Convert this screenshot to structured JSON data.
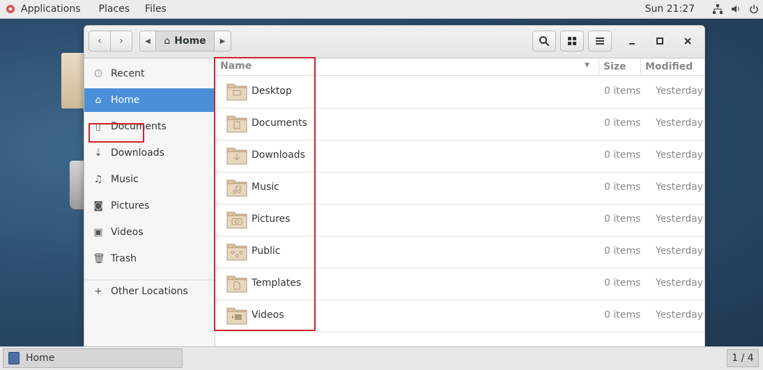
{
  "topbar": {
    "applications": "Applications",
    "places": "Places",
    "files": "Files",
    "clock": "Sun 21:27",
    "tray": [
      "network-icon",
      "volume-icon",
      "power-icon"
    ]
  },
  "header": {
    "path_home": "Home"
  },
  "sidebar": {
    "items": [
      {
        "label": "Recent",
        "icon": "clock-icon"
      },
      {
        "label": "Home",
        "icon": "home-icon",
        "selected": true
      },
      {
        "label": "Documents",
        "icon": "document-icon"
      },
      {
        "label": "Downloads",
        "icon": "download-icon"
      },
      {
        "label": "Music",
        "icon": "music-icon"
      },
      {
        "label": "Pictures",
        "icon": "camera-icon"
      },
      {
        "label": "Videos",
        "icon": "video-icon"
      },
      {
        "label": "Trash",
        "icon": "trash-icon"
      },
      {
        "label": "Other Locations",
        "icon": "plus-icon"
      }
    ]
  },
  "list": {
    "columns": {
      "name": "Name",
      "size": "Size",
      "modified": "Modified"
    },
    "rows": [
      {
        "name": "Desktop",
        "size": "0 items",
        "modified": "Yesterday"
      },
      {
        "name": "Documents",
        "size": "0 items",
        "modified": "Yesterday"
      },
      {
        "name": "Downloads",
        "size": "0 items",
        "modified": "Yesterday"
      },
      {
        "name": "Music",
        "size": "0 items",
        "modified": "Yesterday"
      },
      {
        "name": "Pictures",
        "size": "0 items",
        "modified": "Yesterday"
      },
      {
        "name": "Public",
        "size": "0 items",
        "modified": "Yesterday"
      },
      {
        "name": "Templates",
        "size": "0 items",
        "modified": "Yesterday"
      },
      {
        "name": "Videos",
        "size": "0 items",
        "modified": "Yesterday"
      }
    ]
  },
  "taskbar": {
    "window_label": "Home",
    "workspace": "1 / 4"
  },
  "colors": {
    "accent": "#4a90d9",
    "highlight_box": "#d0202a"
  }
}
